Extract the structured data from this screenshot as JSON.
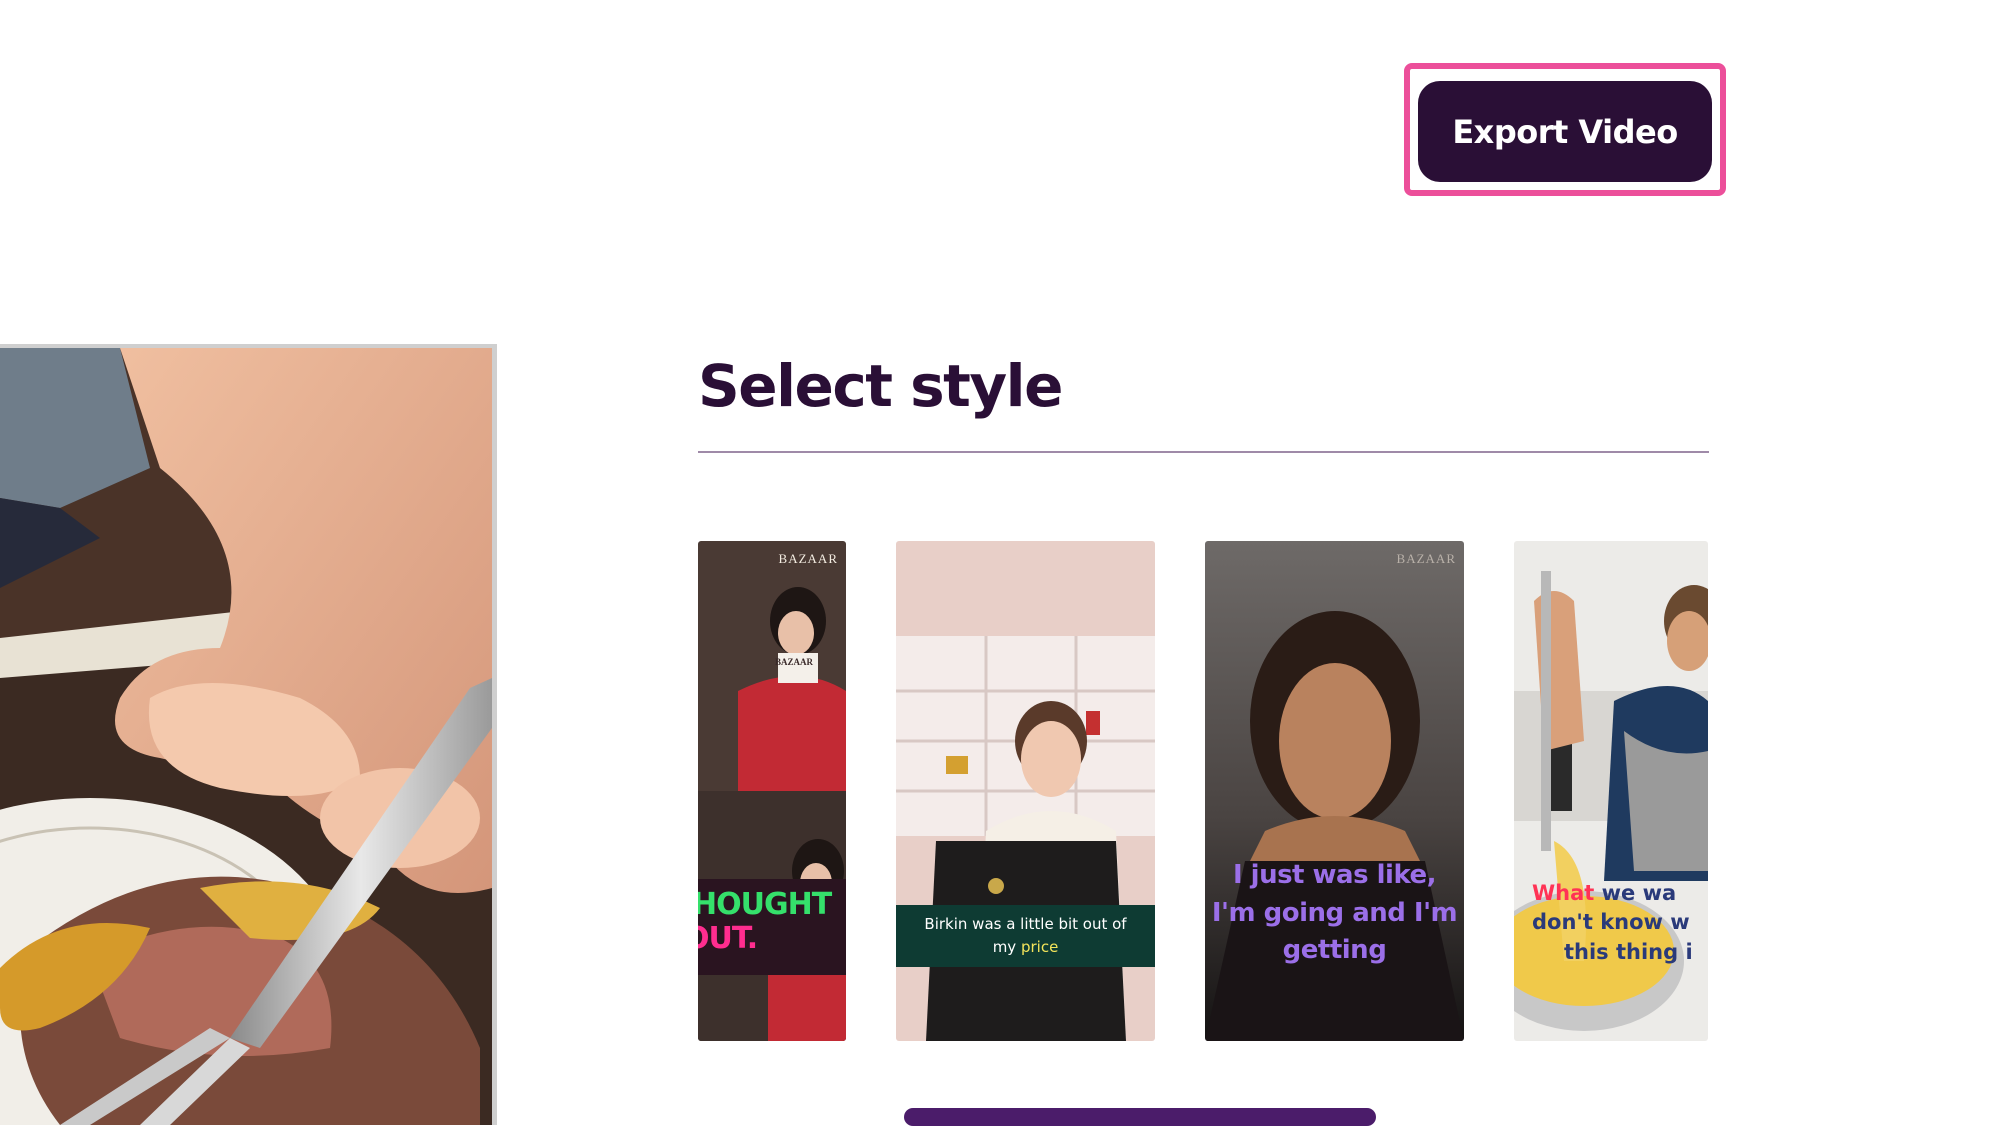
{
  "toolbar": {
    "export_label": "Export Video",
    "accent_color": "#2a0f36",
    "highlight_color": "#ec4f9a"
  },
  "section": {
    "title": "Select style"
  },
  "styles": [
    {
      "brand": "BAZAAR",
      "sign": "BAZAAR",
      "caption_line1": "HOUGHT",
      "caption_line2": "OUT.",
      "caption_colors": [
        "#35e06b",
        "#ff2d8f"
      ]
    },
    {
      "caption_text": "Birkin was a little bit out of my",
      "caption_highlight": "price",
      "caption_color": "#ffffff",
      "highlight_color": "#f3e45a"
    },
    {
      "brand": "BAZAAR",
      "caption_lines": [
        "I just was like,",
        "I'm going and I'm",
        "getting"
      ],
      "caption_color": "#9b6fe8"
    },
    {
      "caption_highlight": "What",
      "caption_line1_rest": " we wa",
      "caption_line2": "don't know w",
      "caption_line3": "this thing i",
      "highlight_color": "#ff3355",
      "caption_color": "#2a3a7a"
    }
  ]
}
